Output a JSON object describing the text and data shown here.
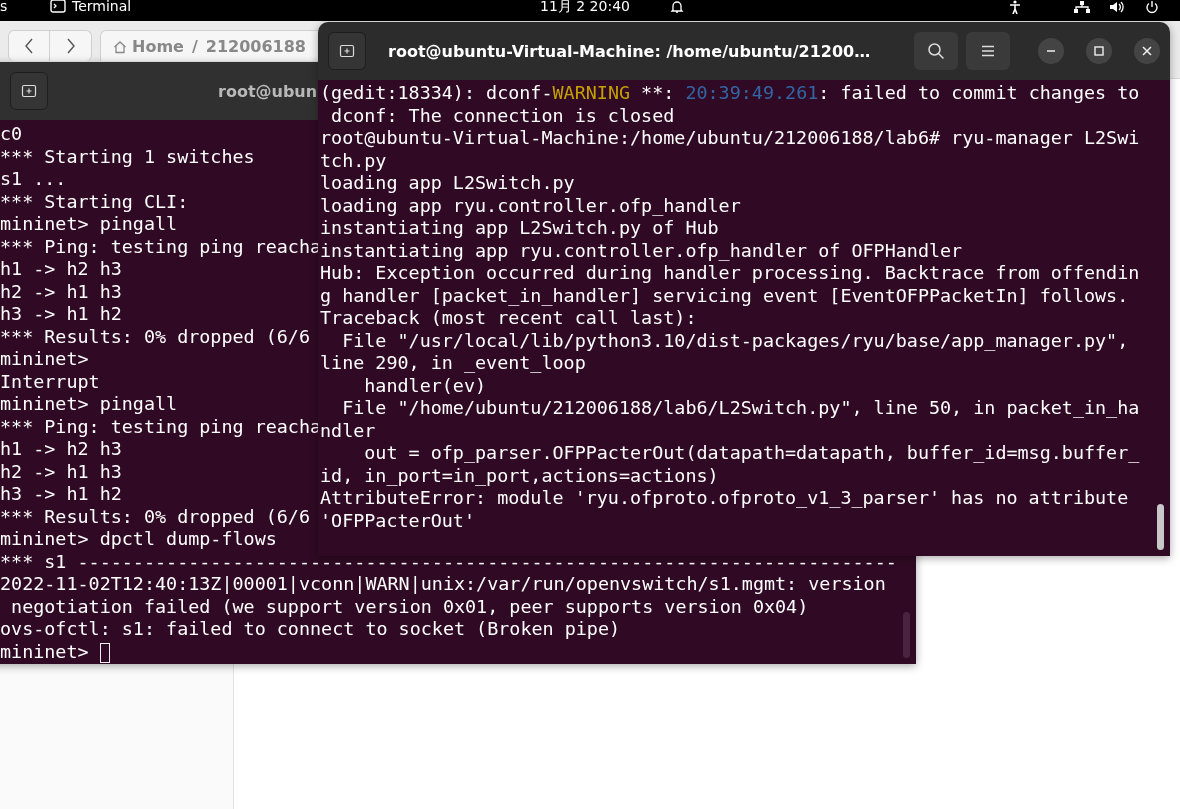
{
  "top_bar": {
    "activities": "s",
    "app_name": "Terminal",
    "clock": "11月 2  20:40"
  },
  "file_manager": {
    "separator": "/",
    "path": [
      {
        "label": "Home",
        "kind": "home"
      },
      {
        "label": "212006188",
        "kind": "folder"
      }
    ]
  },
  "terminals": [
    {
      "title": "root@ubun",
      "focused": false,
      "cursor": true,
      "lines": [
        "c0",
        "*** Starting 1 switches",
        "s1 ...",
        "*** Starting CLI:",
        "mininet> pingall",
        "*** Ping: testing ping reacha",
        "h1 -> h2 h3",
        "h2 -> h1 h3",
        "h3 -> h1 h2",
        "*** Results: 0% dropped (6/6",
        "mininet>",
        "Interrupt",
        "mininet> pingall",
        "*** Ping: testing ping reacha",
        "h1 -> h2 h3",
        "h2 -> h1 h3",
        "h3 -> h1 h2",
        "*** Results: 0% dropped (6/6",
        "mininet> dpctl dump-flows",
        "*** s1 --------------------------------------------------------------------------",
        "2022-11-02T12:40:13Z|00001|vconn|WARN|unix:/var/run/openvswitch/s1.mgmt: version",
        " negotiation failed (we support version 0x01, peer supports version 0x04)",
        "ovs-ofctl: s1: failed to connect to socket (Broken pipe)",
        "mininet> "
      ]
    },
    {
      "title": "root@ubuntu-Virtual-Machine: /home/ubuntu/21200…",
      "focused": true,
      "cursor": false,
      "lines": [
        {
          "segments": [
            {
              "text": "(gedit:18334): dconf-",
              "kind": "plain"
            },
            {
              "text": "WARNING",
              "kind": "warning"
            },
            {
              "text": " **: ",
              "kind": "plain"
            },
            {
              "text": "20:39:49.261",
              "kind": "timestamp"
            },
            {
              "text": ": failed to commit changes to",
              "kind": "plain"
            }
          ]
        },
        " dconf: The connection is closed",
        "root@ubuntu-Virtual-Machine:/home/ubuntu/212006188/lab6# ryu-manager L2Swi",
        "tch.py",
        "loading app L2Switch.py",
        "loading app ryu.controller.ofp_handler",
        "instantiating app L2Switch.py of Hub",
        "instantiating app ryu.controller.ofp_handler of OFPHandler",
        "Hub: Exception occurred during handler processing. Backtrace from offendin",
        "g handler [packet_in_handler] servicing event [EventOFPPacketIn] follows.",
        "Traceback (most recent call last):",
        "  File \"/usr/local/lib/python3.10/dist-packages/ryu/base/app_manager.py\",",
        "line 290, in _event_loop",
        "    handler(ev)",
        "  File \"/home/ubuntu/212006188/lab6/L2Switch.py\", line 50, in packet_in_ha",
        "ndler",
        "    out = ofp_parser.OFPPacterOut(datapath=datapath, buffer_id=msg.buffer_",
        "id, in_port=in_port,actions=actions)",
        "AttributeError: module 'ryu.ofproto.ofproto_v1_3_parser' has no attribute",
        "'OFPPacterOut'"
      ]
    }
  ]
}
